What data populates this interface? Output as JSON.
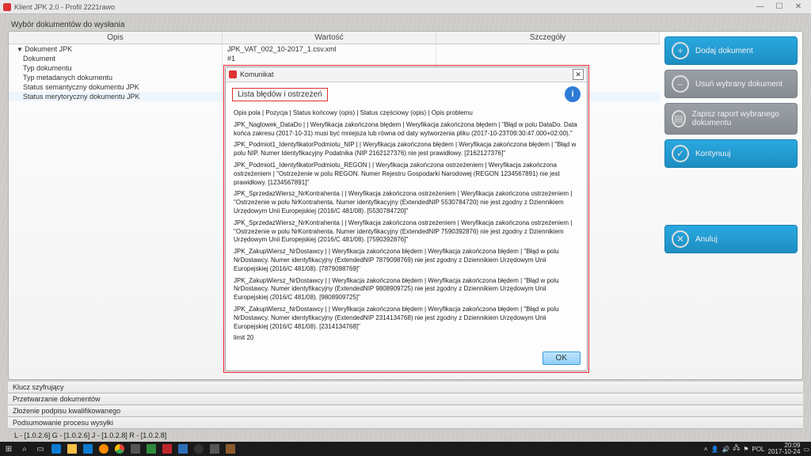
{
  "window": {
    "title": "Klient JPK 2.0 - Profil 2221rawo",
    "minimize": "—",
    "maximize": "☐",
    "close": "✕"
  },
  "section_label": "Wybór dokumentów do wysłania",
  "grid_headers": {
    "opis": "Opis",
    "wartosc": "Wartość",
    "szczegoly": "Szczegóły"
  },
  "tree": {
    "r0": {
      "opis": "Dokument JPK",
      "wartosc": "JPK_VAT_002_10-2017_1.csv.xml"
    },
    "r1": {
      "opis": "Dokument",
      "wartosc": "#1"
    },
    "r2": {
      "opis": "Typ dokumentu",
      "wartosc": ""
    },
    "r3": {
      "opis": "Typ metadanych dokumentu",
      "wartosc": ""
    },
    "r4": {
      "opis": "Status semantyczny dokumentu JPK",
      "wartosc": ""
    },
    "r5": {
      "opis": "Status merytoryczny dokumentu JPK",
      "wartosc": ""
    }
  },
  "actions": {
    "add": "Dodaj dokument",
    "remove": "Usuń wybrany dokument",
    "save": "Zapisz raport wybranego dokumentu",
    "continue": "Kontynuuj",
    "cancel": "Anuluj"
  },
  "bottom_tabs": {
    "t1": "Klucz szyfrujący",
    "t2": "Przetwarzanie dokumentów",
    "t3": "Złożenie podpisu kwalifikowanego",
    "t4": "Podsumowanie procesu wysyłki"
  },
  "statusline": "L - [1.0.2.6] G - [1.0.2.6] J - [1.0.2.8] R - [1.0.2.8]",
  "modal": {
    "title": "Komunikat",
    "close": "✕",
    "heading": "Lista błędów i ostrzeżeń",
    "info_badge": "i",
    "columns_line": "Opis pola | Pozycja | Status końcowy (opis) | Status częściowy (opis) | Opis problemu",
    "b1": "JPK_Naglowek_DataDo |  | Weryfikacja zakończona błędem | Weryfikacja zakończona błędem | \"Błąd w polu DataDo. Data końca zakresu (2017-10-31) musi być mniejsza lub równa od daty wytworzenia pliku (2017-10-23T09:30:47.000+02:00).\"",
    "b2": "JPK_Podmiot1_IdentyfikatorPodmiotu_NIP |  | Weryfikacja zakończona błędem | Weryfikacja zakończona błędem | \"Błąd w polu NIP. Numer Identyfikacyjny Podatnika (NIP 2162127376) nie jest prawidłowy. [2162127376]\"",
    "b3": "JPK_Podmiot1_IdentyfikatorPodmiotu_REGON |  | Weryfikacja zakończona ostrzeżeniem | Weryfikacja zakończona ostrzeżeniem | \"Ostrzeżenie w polu REGON. Numer Rejestru Gospodarki Narodowej (REGON 1234567891) nie jest prawidłowy. [1234567891]\"",
    "b4": "JPK_SprzedazWiersz_NrKontrahenta |  | Weryfikacja zakończona ostrzeżeniem | Weryfikacja zakończona ostrzeżeniem | \"Ostrzeżenie w polu NrKontrahenta. Numer identyfikacyjny (ExtendedNIP 5530784720) nie jest zgodny z Dziennikiem Urzędowym Unii Europejskiej (2016/C 481/08). [5530784720]\"",
    "b5": "JPK_SprzedazWiersz_NrKontrahenta |  | Weryfikacja zakończona ostrzeżeniem | Weryfikacja zakończona ostrzeżeniem | \"Ostrzeżenie w polu NrKontrahenta. Numer identyfikacyjny (ExtendedNIP 7590392876) nie jest zgodny z Dziennikiem Urzędowym Unii Europejskiej (2016/C 481/08). [7590392876]\"",
    "b6": "JPK_ZakupWiersz_NrDostawcy |  | Weryfikacja zakończona błędem | Weryfikacja zakończona błędem | \"Błąd w polu NrDostawcy. Numer identyfikacyjny (ExtendedNIP 7879098769) nie jest zgodny z Dziennikiem Urzędowym Unii Europejskiej (2016/C 481/08). [7879098769]\"",
    "b7": "JPK_ZakupWiersz_NrDostawcy |  | Weryfikacja zakończona błędem | Weryfikacja zakończona błędem | \"Błąd w polu NrDostawcy. Numer identyfikacyjny (ExtendedNIP 9808909725) nie jest zgodny z Dziennikiem Urzędowym Unii Europejskiej (2016/C 481/08). [9808909725]\"",
    "b8": "JPK_ZakupWiersz_NrDostawcy |  | Weryfikacja zakończona błędem | Weryfikacja zakończona błędem | \"Błąd w polu NrDostawcy. Numer identyfikacyjny (ExtendedNIP 2314134768) nie jest zgodny z Dziennikiem Urzędowym Unii Europejskiej (2016/C 481/08). [2314134768]\"",
    "limit": "limit 20",
    "ok": "OK"
  },
  "taskbar": {
    "lang": "POL",
    "date": "2017-10-24",
    "time": "20:09"
  }
}
